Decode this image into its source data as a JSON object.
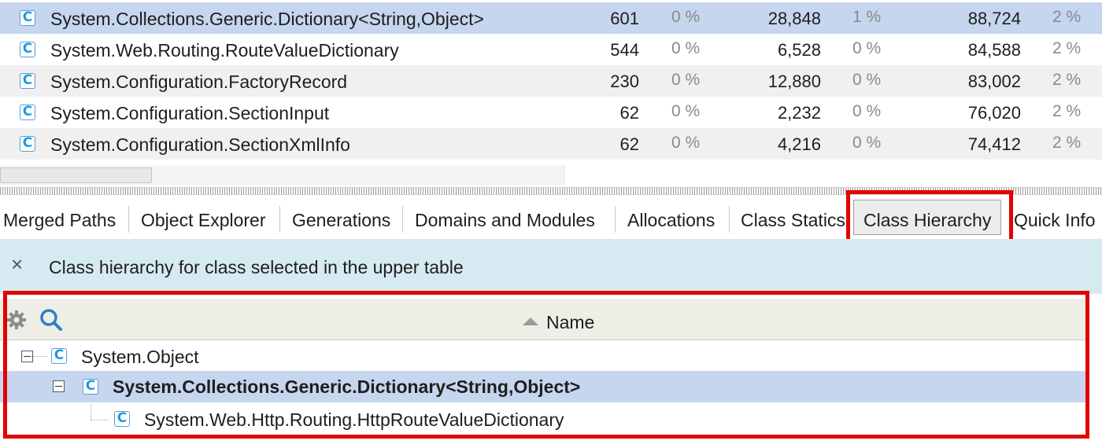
{
  "upper_table": {
    "rows": [
      {
        "name": "System.Collections.Generic.Dictionary<String,Object>",
        "count": "601",
        "count_pct": "0 %",
        "shallow": "28,848",
        "shallow_pct": "1 %",
        "retained": "88,724",
        "retained_pct": "2 %",
        "selected": true
      },
      {
        "name": "System.Web.Routing.RouteValueDictionary",
        "count": "544",
        "count_pct": "0 %",
        "shallow": "6,528",
        "shallow_pct": "0 %",
        "retained": "84,588",
        "retained_pct": "2 %"
      },
      {
        "name": "System.Configuration.FactoryRecord",
        "count": "230",
        "count_pct": "0 %",
        "shallow": "12,880",
        "shallow_pct": "0 %",
        "retained": "83,002",
        "retained_pct": "2 %"
      },
      {
        "name": "System.Configuration.SectionInput",
        "count": "62",
        "count_pct": "0 %",
        "shallow": "2,232",
        "shallow_pct": "0 %",
        "retained": "76,020",
        "retained_pct": "2 %"
      },
      {
        "name": "System.Configuration.SectionXmlInfo",
        "count": "62",
        "count_pct": "0 %",
        "shallow": "4,216",
        "shallow_pct": "0 %",
        "retained": "74,412",
        "retained_pct": "2 %"
      }
    ],
    "class_icon_letter": "C"
  },
  "tabs": [
    {
      "label": "Merged Paths"
    },
    {
      "label": "Object Explorer"
    },
    {
      "label": "Generations"
    },
    {
      "label": "Domains and Modules"
    },
    {
      "label": "Allocations"
    },
    {
      "label": "Class Statics"
    },
    {
      "label": "Class Hierarchy",
      "active": true
    },
    {
      "label": "Quick Info"
    }
  ],
  "info_bar": {
    "text": "Class hierarchy for class selected in the upper table",
    "close_glyph": "×"
  },
  "hierarchy": {
    "column_name": "Name",
    "nodes": [
      {
        "name": "System.Object",
        "bold": false
      },
      {
        "name": "System.Collections.Generic.Dictionary<String,Object>",
        "bold": true,
        "selected": true
      },
      {
        "name": "System.Web.Http.Routing.HttpRouteValueDictionary",
        "bold": false
      }
    ]
  },
  "colors": {
    "selection": "#c5d6ee",
    "info_bar": "#d6eaf1",
    "highlight_box": "#e30000",
    "class_icon": "#1a9be0"
  }
}
